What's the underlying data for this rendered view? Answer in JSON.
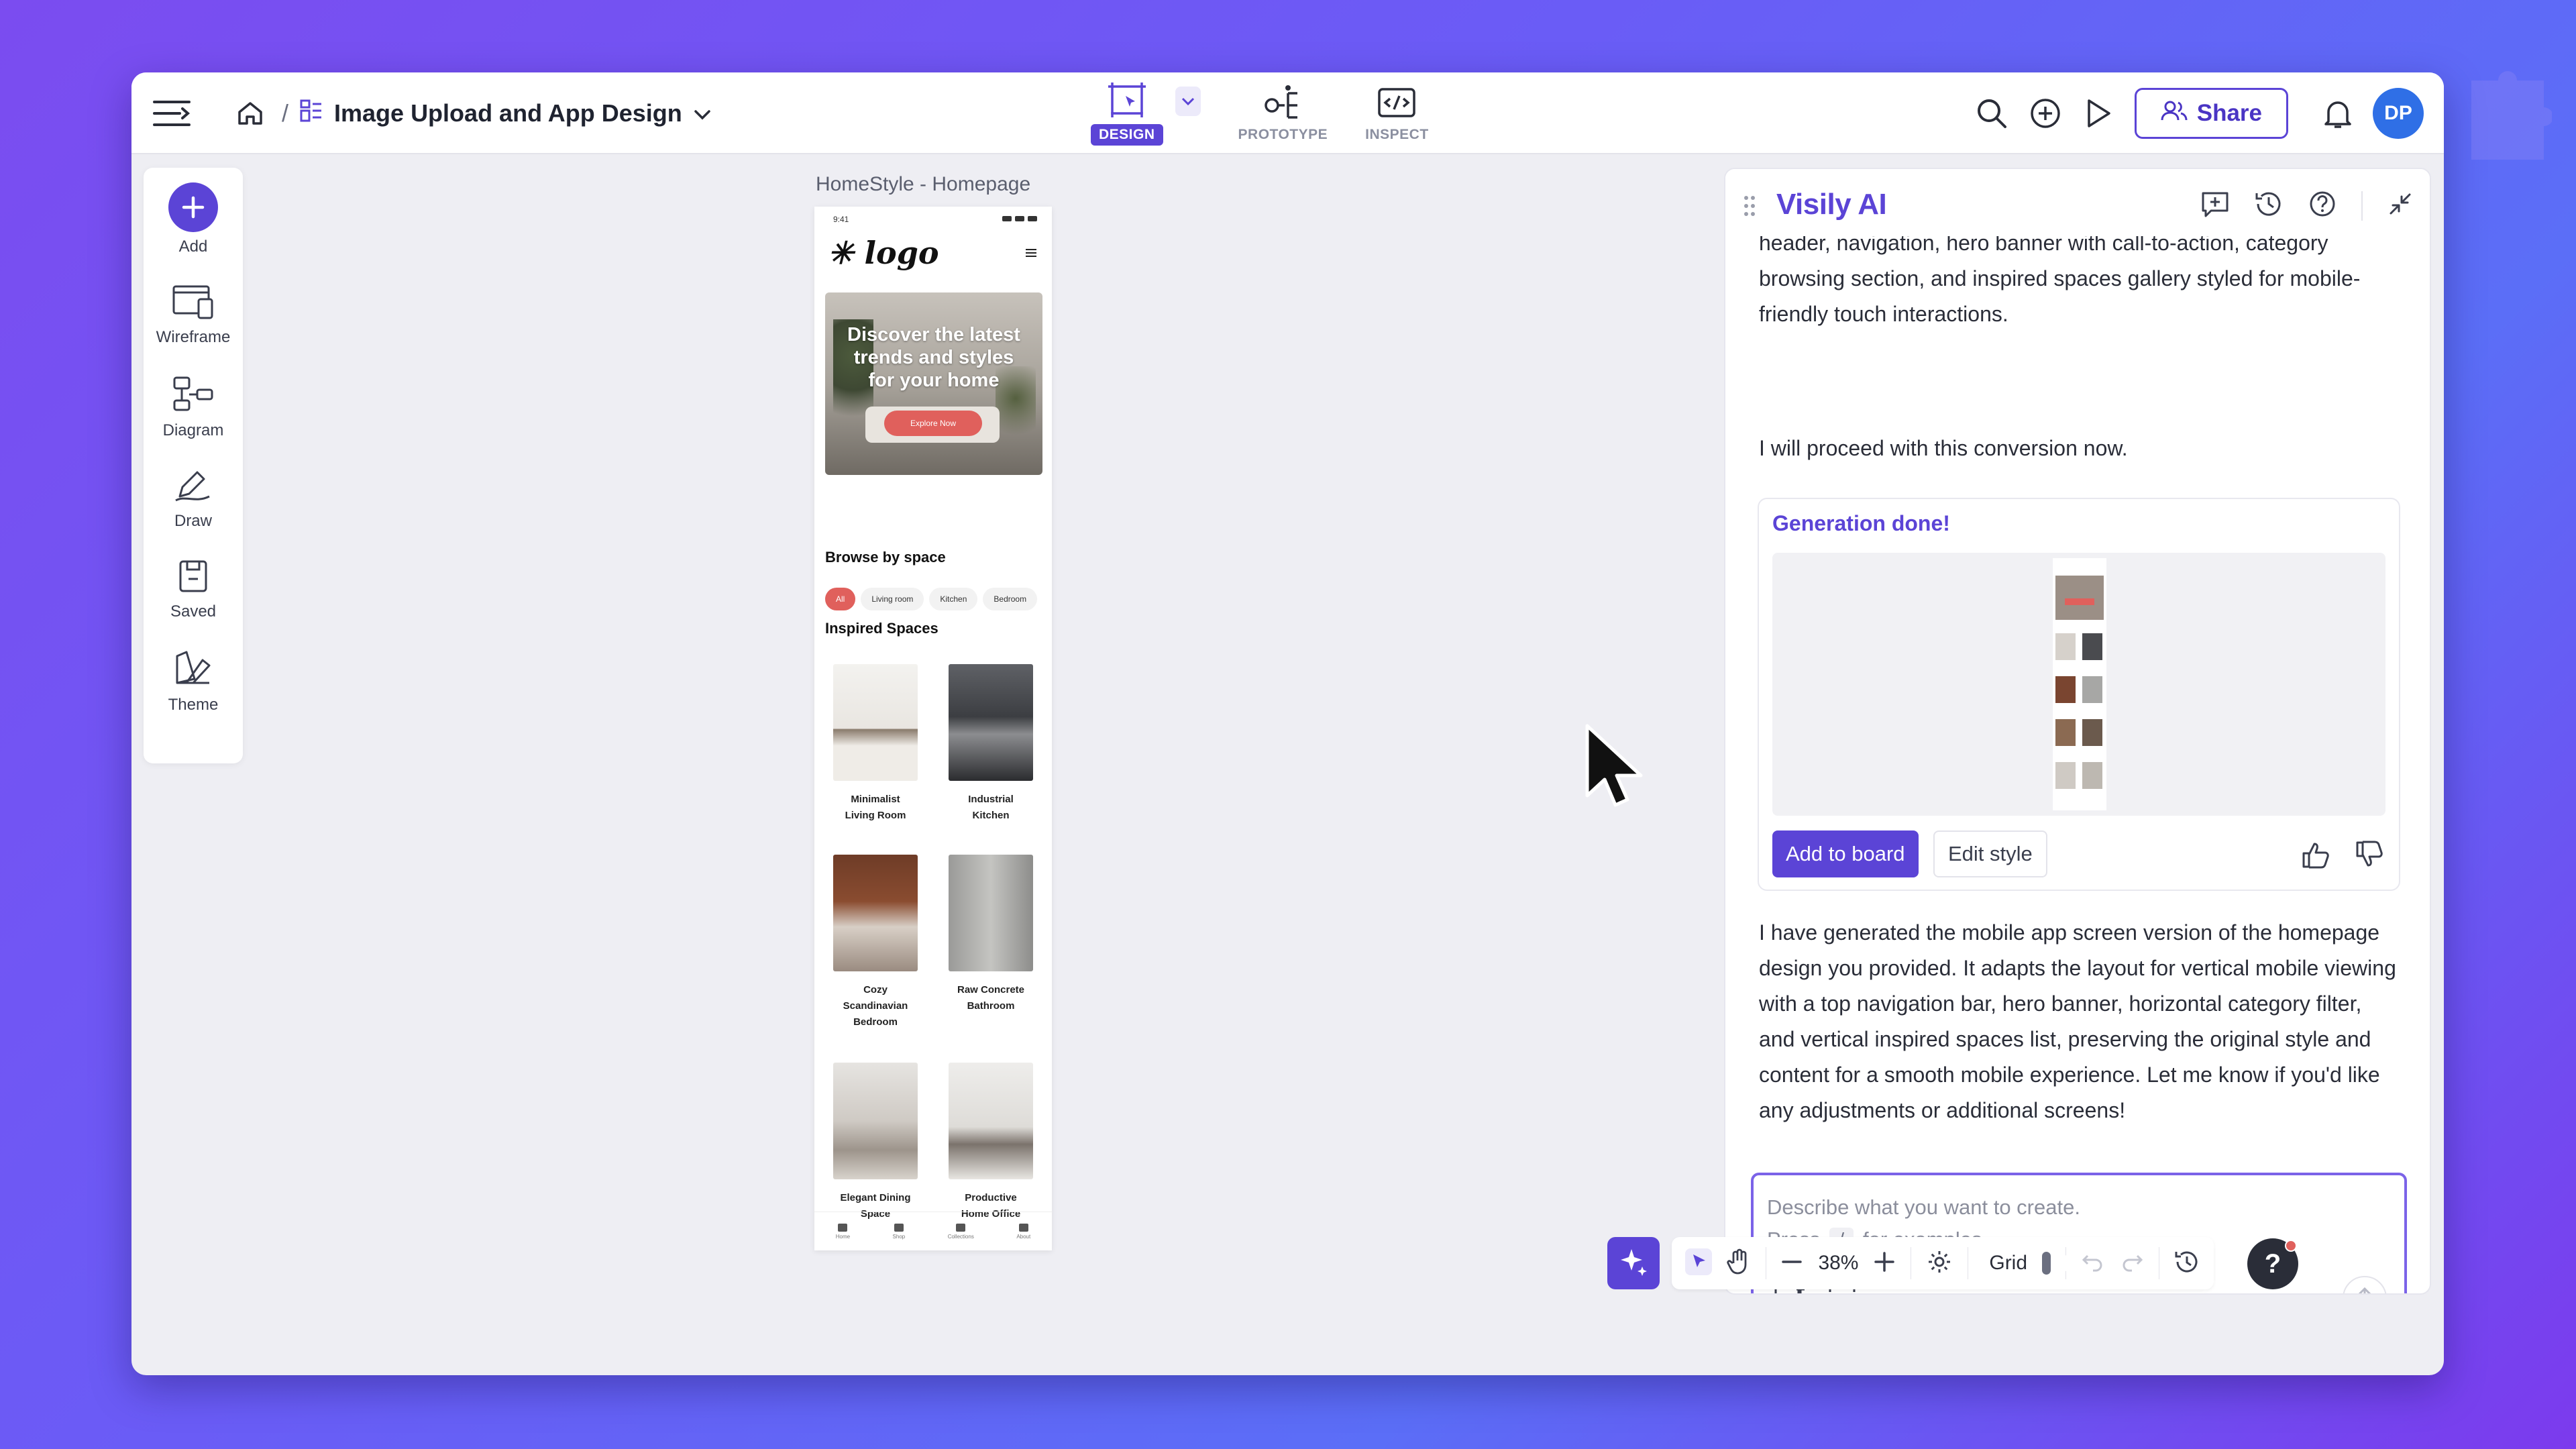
{
  "header": {
    "title": "Image Upload and App Design",
    "breadcrumb_sep": "/",
    "modes": [
      {
        "label": "DESIGN",
        "active": true
      },
      {
        "label": "PROTOTYPE",
        "active": false
      },
      {
        "label": "INSPECT",
        "active": false
      }
    ],
    "share_label": "Share",
    "avatar_initials": "DP"
  },
  "left_tools": [
    {
      "label": "Add",
      "icon": "plus-icon"
    },
    {
      "label": "Wireframe",
      "icon": "wireframe-icon"
    },
    {
      "label": "Diagram",
      "icon": "diagram-icon"
    },
    {
      "label": "Draw",
      "icon": "draw-icon"
    },
    {
      "label": "Saved",
      "icon": "saved-icon"
    },
    {
      "label": "Theme",
      "icon": "theme-icon"
    }
  ],
  "canvas": {
    "frame_label": "HomeStyle - Homepage",
    "phone": {
      "time": "9:41",
      "logo": "✳ logo",
      "hero_text": "Discover the latest trends and styles for your home",
      "hero_button": "Explore Now",
      "browse_title": "Browse by space",
      "chips": [
        "All",
        "Living room",
        "Kitchen",
        "Bedroom"
      ],
      "inspired_title": "Inspired Spaces",
      "cards": [
        {
          "line1": "Minimalist",
          "line2": "Living Room",
          "line3": ""
        },
        {
          "line1": "Industrial",
          "line2": "Kitchen",
          "line3": ""
        },
        {
          "line1": "Cozy",
          "line2": "Scandinavian",
          "line3": "Bedroom"
        },
        {
          "line1": "Raw Concrete",
          "line2": "Bathroom",
          "line3": ""
        },
        {
          "line1": "Elegant Dining",
          "line2": "Space",
          "line3": ""
        },
        {
          "line1": "Productive",
          "line2": "Home Office",
          "line3": ""
        }
      ],
      "nav": [
        "Home",
        "Shop",
        "Collections",
        "About"
      ]
    }
  },
  "ai_panel": {
    "title": "Visily AI",
    "msg_top": "header, navigation, hero banner with call-to-action, category browsing section, and inspired spaces gallery styled for mobile-friendly touch interactions.",
    "msg_proceed": "I will proceed with this conversion now.",
    "generation_title": "Generation done!",
    "add_to_board": "Add to board",
    "edit_style": "Edit style",
    "msg_result": "I have generated the mobile app screen version of the homepage design you provided. It adapts the layout for vertical mobile viewing with a top navigation bar, hero banner, horizontal category filter, and vertical inspired spaces list, preserving the original style and content for a smooth mobile experience. Let me know if you'd like any adjustments or additional screens!",
    "prompt_placeholder_1": "Describe what you want to create.",
    "prompt_press": "Press",
    "prompt_key": "/",
    "prompt_examples": "for examples"
  },
  "bottom_bar": {
    "zoom": "38%",
    "grid_label": "Grid",
    "help": "?"
  },
  "colors": {
    "accent": "#5b44d6",
    "hero_button": "#e0605c",
    "avatar": "#2f6fe6"
  }
}
